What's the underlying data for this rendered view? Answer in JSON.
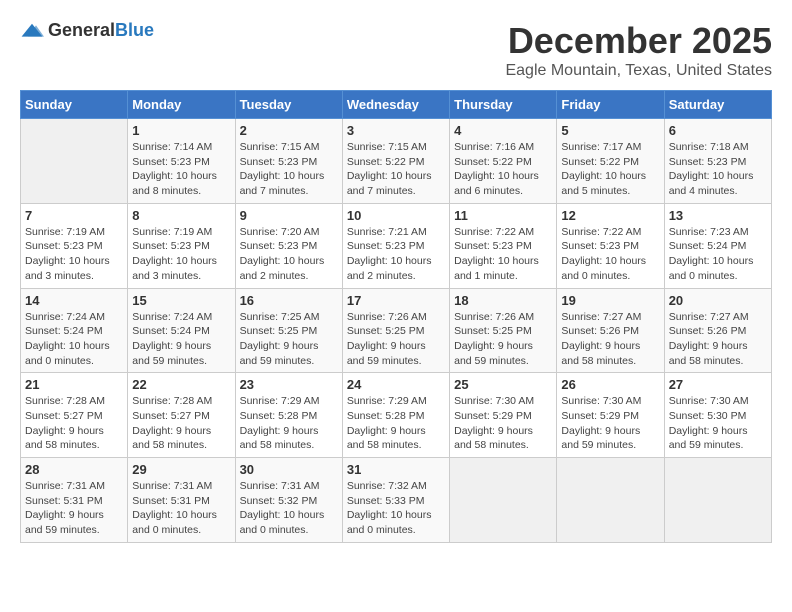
{
  "header": {
    "logo_general": "General",
    "logo_blue": "Blue",
    "title": "December 2025",
    "subtitle": "Eagle Mountain, Texas, United States"
  },
  "days_of_week": [
    "Sunday",
    "Monday",
    "Tuesday",
    "Wednesday",
    "Thursday",
    "Friday",
    "Saturday"
  ],
  "weeks": [
    [
      {
        "day": "",
        "info": ""
      },
      {
        "day": "1",
        "info": "Sunrise: 7:14 AM\nSunset: 5:23 PM\nDaylight: 10 hours\nand 8 minutes."
      },
      {
        "day": "2",
        "info": "Sunrise: 7:15 AM\nSunset: 5:23 PM\nDaylight: 10 hours\nand 7 minutes."
      },
      {
        "day": "3",
        "info": "Sunrise: 7:15 AM\nSunset: 5:22 PM\nDaylight: 10 hours\nand 7 minutes."
      },
      {
        "day": "4",
        "info": "Sunrise: 7:16 AM\nSunset: 5:22 PM\nDaylight: 10 hours\nand 6 minutes."
      },
      {
        "day": "5",
        "info": "Sunrise: 7:17 AM\nSunset: 5:22 PM\nDaylight: 10 hours\nand 5 minutes."
      },
      {
        "day": "6",
        "info": "Sunrise: 7:18 AM\nSunset: 5:23 PM\nDaylight: 10 hours\nand 4 minutes."
      }
    ],
    [
      {
        "day": "7",
        "info": "Sunrise: 7:19 AM\nSunset: 5:23 PM\nDaylight: 10 hours\nand 3 minutes."
      },
      {
        "day": "8",
        "info": "Sunrise: 7:19 AM\nSunset: 5:23 PM\nDaylight: 10 hours\nand 3 minutes."
      },
      {
        "day": "9",
        "info": "Sunrise: 7:20 AM\nSunset: 5:23 PM\nDaylight: 10 hours\nand 2 minutes."
      },
      {
        "day": "10",
        "info": "Sunrise: 7:21 AM\nSunset: 5:23 PM\nDaylight: 10 hours\nand 2 minutes."
      },
      {
        "day": "11",
        "info": "Sunrise: 7:22 AM\nSunset: 5:23 PM\nDaylight: 10 hours\nand 1 minute."
      },
      {
        "day": "12",
        "info": "Sunrise: 7:22 AM\nSunset: 5:23 PM\nDaylight: 10 hours\nand 0 minutes."
      },
      {
        "day": "13",
        "info": "Sunrise: 7:23 AM\nSunset: 5:24 PM\nDaylight: 10 hours\nand 0 minutes."
      }
    ],
    [
      {
        "day": "14",
        "info": "Sunrise: 7:24 AM\nSunset: 5:24 PM\nDaylight: 10 hours\nand 0 minutes."
      },
      {
        "day": "15",
        "info": "Sunrise: 7:24 AM\nSunset: 5:24 PM\nDaylight: 9 hours\nand 59 minutes."
      },
      {
        "day": "16",
        "info": "Sunrise: 7:25 AM\nSunset: 5:25 PM\nDaylight: 9 hours\nand 59 minutes."
      },
      {
        "day": "17",
        "info": "Sunrise: 7:26 AM\nSunset: 5:25 PM\nDaylight: 9 hours\nand 59 minutes."
      },
      {
        "day": "18",
        "info": "Sunrise: 7:26 AM\nSunset: 5:25 PM\nDaylight: 9 hours\nand 59 minutes."
      },
      {
        "day": "19",
        "info": "Sunrise: 7:27 AM\nSunset: 5:26 PM\nDaylight: 9 hours\nand 58 minutes."
      },
      {
        "day": "20",
        "info": "Sunrise: 7:27 AM\nSunset: 5:26 PM\nDaylight: 9 hours\nand 58 minutes."
      }
    ],
    [
      {
        "day": "21",
        "info": "Sunrise: 7:28 AM\nSunset: 5:27 PM\nDaylight: 9 hours\nand 58 minutes."
      },
      {
        "day": "22",
        "info": "Sunrise: 7:28 AM\nSunset: 5:27 PM\nDaylight: 9 hours\nand 58 minutes."
      },
      {
        "day": "23",
        "info": "Sunrise: 7:29 AM\nSunset: 5:28 PM\nDaylight: 9 hours\nand 58 minutes."
      },
      {
        "day": "24",
        "info": "Sunrise: 7:29 AM\nSunset: 5:28 PM\nDaylight: 9 hours\nand 58 minutes."
      },
      {
        "day": "25",
        "info": "Sunrise: 7:30 AM\nSunset: 5:29 PM\nDaylight: 9 hours\nand 58 minutes."
      },
      {
        "day": "26",
        "info": "Sunrise: 7:30 AM\nSunset: 5:29 PM\nDaylight: 9 hours\nand 59 minutes."
      },
      {
        "day": "27",
        "info": "Sunrise: 7:30 AM\nSunset: 5:30 PM\nDaylight: 9 hours\nand 59 minutes."
      }
    ],
    [
      {
        "day": "28",
        "info": "Sunrise: 7:31 AM\nSunset: 5:31 PM\nDaylight: 9 hours\nand 59 minutes."
      },
      {
        "day": "29",
        "info": "Sunrise: 7:31 AM\nSunset: 5:31 PM\nDaylight: 10 hours\nand 0 minutes."
      },
      {
        "day": "30",
        "info": "Sunrise: 7:31 AM\nSunset: 5:32 PM\nDaylight: 10 hours\nand 0 minutes."
      },
      {
        "day": "31",
        "info": "Sunrise: 7:32 AM\nSunset: 5:33 PM\nDaylight: 10 hours\nand 0 minutes."
      },
      {
        "day": "",
        "info": ""
      },
      {
        "day": "",
        "info": ""
      },
      {
        "day": "",
        "info": ""
      }
    ]
  ]
}
